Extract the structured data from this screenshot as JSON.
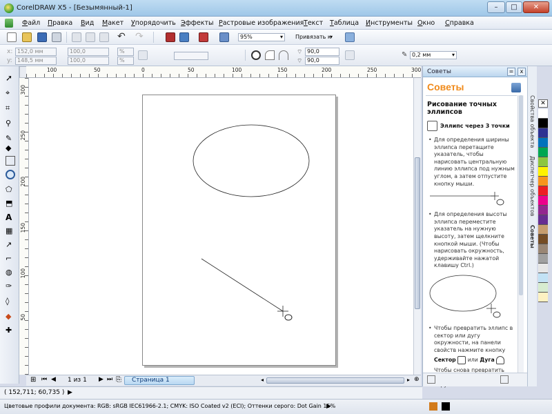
{
  "window": {
    "title": "CorelDRAW X5 - [Безымянный-1]",
    "min_glyph": "–",
    "max_glyph": "□",
    "close_glyph": "✕"
  },
  "menu": [
    "Файл",
    "Правка",
    "Вид",
    "Макет",
    "Упорядочить",
    "Эффекты",
    "Растровые изображения",
    "Текст",
    "Таблица",
    "Инструменты",
    "Окно",
    "Справка"
  ],
  "toolbar": {
    "zoom": "95%",
    "snap": "Привязать к"
  },
  "propbar": {
    "x": "152,0 мм",
    "y": "148,5 мм",
    "w": "100,0",
    "h": "100,0",
    "scale": "%",
    "angle1": "90,0",
    "angle2": "90,0",
    "outline": "0,2 мм"
  },
  "ruler_h_labels": [
    "100",
    "50",
    "0",
    "50",
    "100",
    "150",
    "200",
    "250",
    "300"
  ],
  "ruler_v_labels": [
    "300",
    "250",
    "200",
    "150",
    "100",
    "50"
  ],
  "pagebar": {
    "page_count": "1 из 1",
    "page_tab": "Страница 1"
  },
  "status": {
    "coords": "( 152,711; 60,735 )",
    "profile": "Цветовые профили документа: RGB: sRGB IEC61966-2.1; CMYK: ISO Coated v2 (ECI); Оттенки серого: Dot Gain 15%"
  },
  "docker": {
    "header": "Советы",
    "brand": "Советы",
    "pin_glyph": "=",
    "close_glyph": "x",
    "title": "Рисование точных эллипсов",
    "tool_label": "Эллипс через 3 точки",
    "para1": "Для определения ширины эллипса перетащите указатель, чтобы нарисовать центральную линию эллипса под нужным углом, а затем отпустите кнопку мыши.",
    "para2": "Для определения высоты эллипса переместите указатель на нужную высоту, затем щелкните кнопкой мыши. (Чтобы нарисовать окружность, удерживайте нажатой клавишу Ctrl.)",
    "para3": "Чтобы превратить эллипс в сектор или дугу окружности, на панели свойств нажмите кнопку",
    "sector": "Сектор",
    "or_word": "или",
    "arc": "Дуга",
    "para4": "Чтобы снова превратить сектор или дугу окружности"
  },
  "vtabs": [
    "Свойства объекта",
    "Диспетчер объектов",
    "Советы"
  ],
  "palette_colors": [
    "#ffffff",
    "#000000",
    "#2e3192",
    "#0072bc",
    "#00a651",
    "#8dc63f",
    "#fff200",
    "#f7941d",
    "#ed1c24",
    "#ec008c",
    "#92278f",
    "#662d91",
    "#c69c6d",
    "#754c24",
    "#998675",
    "#a0a0a0",
    "#e6e6e6",
    "#c2e2f5",
    "#d7ecd0",
    "#fdf1c2"
  ]
}
